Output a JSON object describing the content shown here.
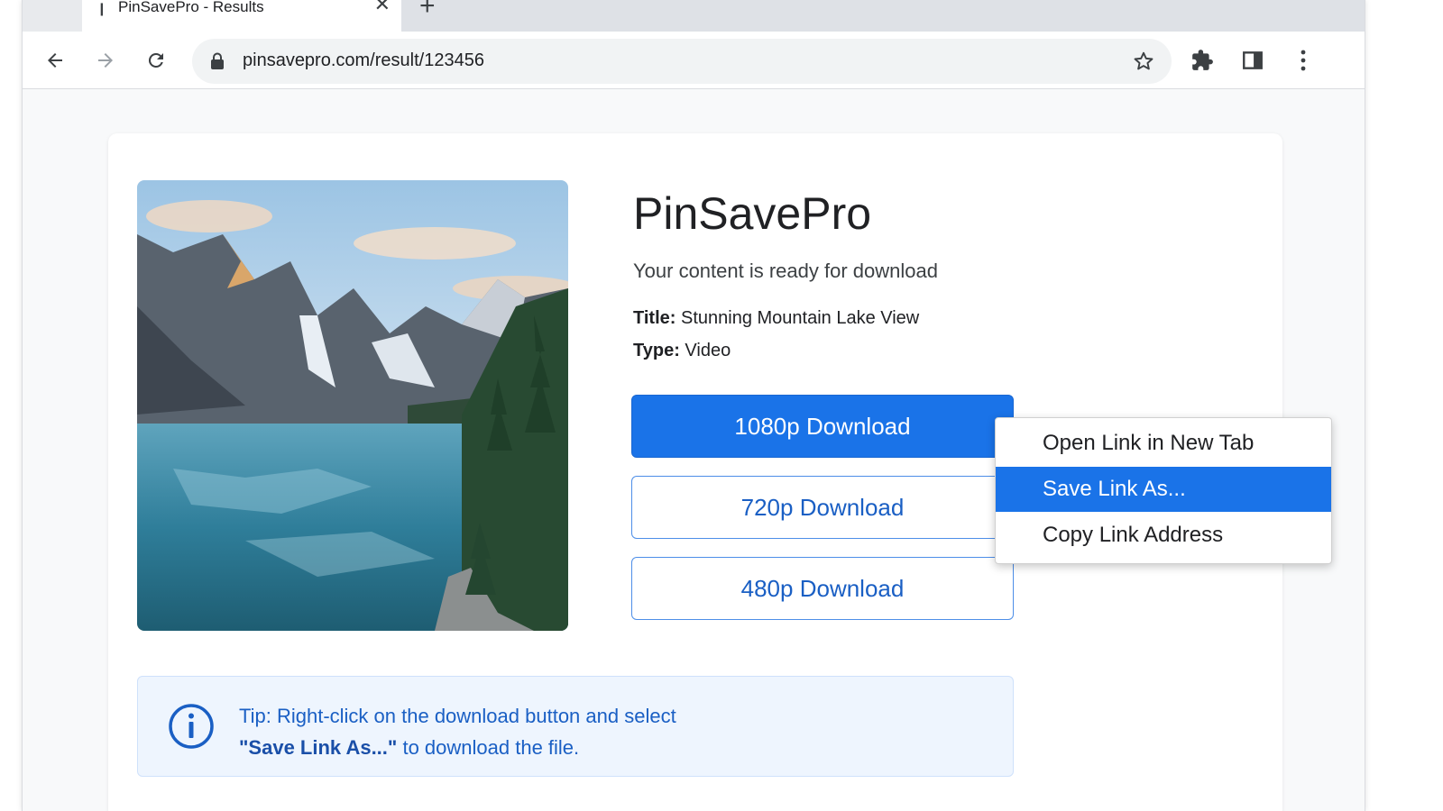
{
  "tab": {
    "title": "PinSavePro - Results"
  },
  "address_bar": {
    "url": "pinsavepro.com/result/123456"
  },
  "page": {
    "app_name": "PinSavePro",
    "subtitle": "Your content is ready for download",
    "title_label": "Title:",
    "title_value": "Stunning Mountain Lake View",
    "type_label": "Type:",
    "type_value": "Video",
    "buttons": [
      "1080p Download",
      "720p Download",
      "480p Download"
    ],
    "tip_line1": "Tip: Right-click on the download button and select",
    "tip_bold": "\"Save Link As...\"",
    "tip_line2_rest": " to download the file."
  },
  "context_menu": {
    "items": [
      "Open Link in New Tab",
      "Save Link As...",
      "Copy Link Address"
    ],
    "highlighted_index": 1
  },
  "colors": {
    "accent": "#1a73e8",
    "tip_background": "#eef5fe",
    "tip_text": "#1a5fc4"
  },
  "icons": {
    "tab_favicon": "pin-icon",
    "toolbar": [
      "back-arrow-icon",
      "forward-arrow-icon",
      "reload-icon",
      "lock-icon",
      "star-icon",
      "puzzle-extension-icon",
      "side-panel-icon",
      "more-vert-icon"
    ],
    "tip": "info-icon"
  }
}
